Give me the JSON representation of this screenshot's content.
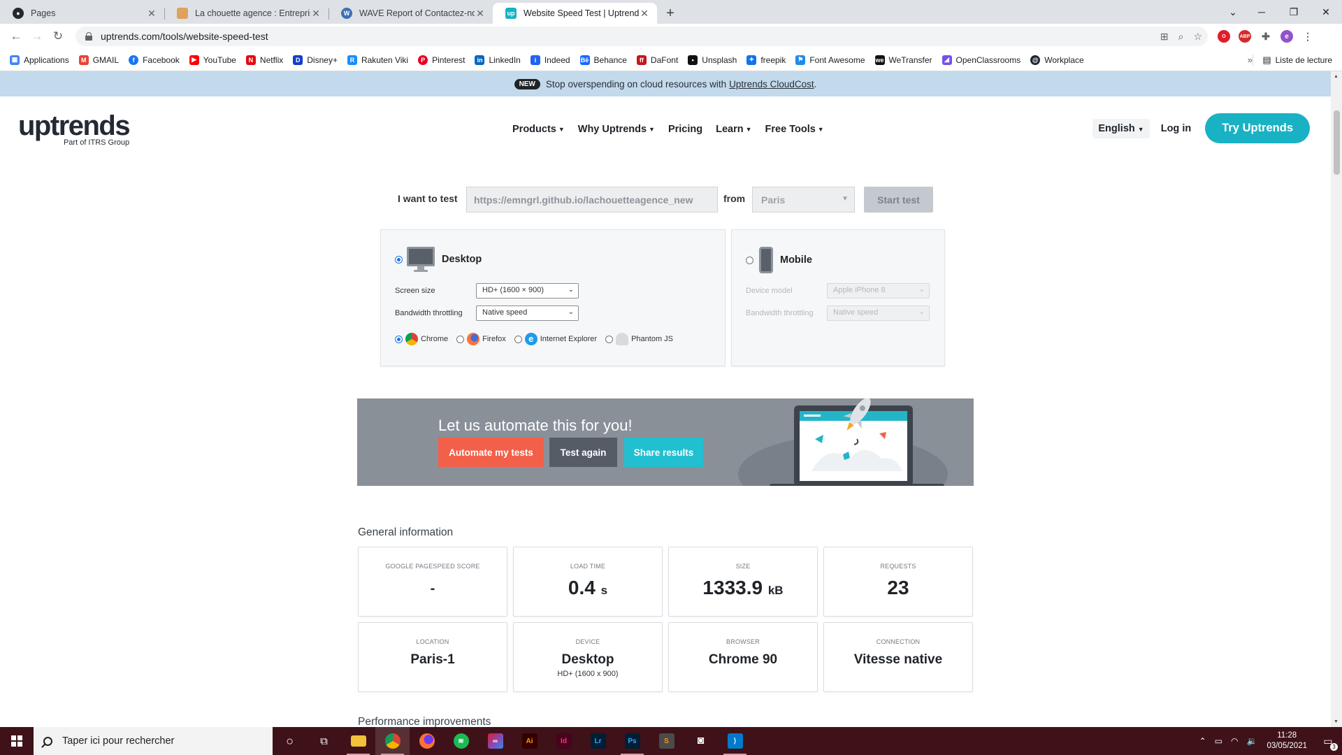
{
  "browser": {
    "tabs": [
      {
        "title": "Pages",
        "favicon": "github-icon",
        "color": "#24292f",
        "active": false
      },
      {
        "title": "La chouette agence : Entreprise w",
        "favicon": "owl-icon",
        "color": "#e0a15a",
        "active": false
      },
      {
        "title": "WAVE Report of Contactez-nous",
        "favicon": "wave-icon",
        "color": "#3c6fb6",
        "active": false
      },
      {
        "title": "Website Speed Test | Uptrends",
        "favicon": "uptrends-icon",
        "color": "#18b2c4",
        "active": true
      }
    ],
    "new_tab": "+",
    "url": "uptrends.com/tools/website-speed-test",
    "bookmarks": [
      {
        "label": "Applications",
        "icon": "apps-grid-icon",
        "color": "#4285f4"
      },
      {
        "label": "GMAIL",
        "icon": "gmail-icon",
        "color": "#ea4335"
      },
      {
        "label": "Facebook",
        "icon": "facebook-icon",
        "color": "#1877f2"
      },
      {
        "label": "YouTube",
        "icon": "youtube-icon",
        "color": "#ff0000"
      },
      {
        "label": "Netflix",
        "icon": "netflix-icon",
        "color": "#e50914"
      },
      {
        "label": "Disney+",
        "icon": "disney-icon",
        "color": "#113ccf"
      },
      {
        "label": "Rakuten Viki",
        "icon": "viki-icon",
        "color": "#1a8cff"
      },
      {
        "label": "Pinterest",
        "icon": "pinterest-icon",
        "color": "#e60023"
      },
      {
        "label": "LinkedIn",
        "icon": "linkedin-icon",
        "color": "#0a66c2"
      },
      {
        "label": "Indeed",
        "icon": "indeed-icon",
        "color": "#2164f3"
      },
      {
        "label": "Behance",
        "icon": "behance-icon",
        "color": "#1769ff"
      },
      {
        "label": "DaFont",
        "icon": "dafont-icon",
        "color": "#c4161c"
      },
      {
        "label": "Unsplash",
        "icon": "unsplash-icon",
        "color": "#111111"
      },
      {
        "label": "freepik",
        "icon": "freepik-icon",
        "color": "#1273eb"
      },
      {
        "label": "Font Awesome",
        "icon": "fontawesome-icon",
        "color": "#228ae6"
      },
      {
        "label": "WeTransfer",
        "icon": "wetransfer-icon",
        "color": "#111111"
      },
      {
        "label": "OpenClassrooms",
        "icon": "openclassrooms-icon",
        "color": "#7451eb"
      },
      {
        "label": "Workplace",
        "icon": "workplace-icon",
        "color": "#20252d"
      }
    ],
    "bookmarks_more": "»",
    "reading_list": "Liste de lecture"
  },
  "promo": {
    "badge": "NEW",
    "text": "Stop overspending on cloud resources with",
    "link": "Uptrends CloudCost",
    "suffix": "."
  },
  "header": {
    "logo": "uptrends",
    "logo_sub": "Part of ITRS Group",
    "nav": [
      "Products",
      "Why Uptrends",
      "Pricing",
      "Learn",
      "Free Tools"
    ],
    "language": "English",
    "login": "Log in",
    "cta": "Try Uptrends"
  },
  "test_form": {
    "want_label": "I want to test",
    "url_value": "https://emngrl.github.io/lachouetteagence_new",
    "from_label": "from",
    "location": "Paris",
    "start_label": "Start test"
  },
  "desktop": {
    "title": "Desktop",
    "screen_size_label": "Screen size",
    "screen_size": "HD+ (1600 × 900)",
    "bandwidth_label": "Bandwidth throttling",
    "bandwidth": "Native speed",
    "browsers": [
      "Chrome",
      "Firefox",
      "Internet Explorer",
      "Phantom JS"
    ],
    "selected_browser": "Chrome"
  },
  "mobile": {
    "title": "Mobile",
    "device_label": "Device model",
    "device": "Apple iPhone 8",
    "bandwidth_label": "Bandwidth throttling",
    "bandwidth": "Native speed"
  },
  "automate": {
    "title": "Let us automate this for you!",
    "btn_automate": "Automate my tests",
    "btn_again": "Test again",
    "btn_share": "Share results"
  },
  "general": {
    "title": "General information",
    "pagespeed": {
      "label": "GOOGLE PAGESPEED SCORE",
      "value": "-"
    },
    "load_time": {
      "label": "LOAD TIME",
      "value": "0.4",
      "unit": "s"
    },
    "size": {
      "label": "SIZE",
      "value": "1333.9",
      "unit": "kB"
    },
    "requests": {
      "label": "REQUESTS",
      "value": "23"
    },
    "location": {
      "label": "LOCATION",
      "value": "Paris-1"
    },
    "device": {
      "label": "DEVICE",
      "value": "Desktop",
      "sub": "HD+ (1600 x 900)"
    },
    "browser": {
      "label": "BROWSER",
      "value": "Chrome 90"
    },
    "connection": {
      "label": "CONNECTION",
      "value": "Vitesse native"
    }
  },
  "performance_title": "Performance improvements",
  "taskbar": {
    "search_placeholder": "Taper ici pour rechercher",
    "apps": [
      {
        "name": "cortana-icon",
        "label": "○",
        "color": "transparent"
      },
      {
        "name": "task-view-icon",
        "label": "⧉",
        "color": "transparent"
      },
      {
        "name": "file-explorer-icon",
        "label": "",
        "color": "#f3c13a"
      },
      {
        "name": "chrome-icon",
        "label": "",
        "color": "#db4437"
      },
      {
        "name": "firefox-icon",
        "label": "",
        "color": "#ff7139"
      },
      {
        "name": "spotify-icon",
        "label": "",
        "color": "#1db954"
      },
      {
        "name": "creative-cloud-icon",
        "label": "",
        "color": "#da1f26"
      },
      {
        "name": "illustrator-icon",
        "label": "Ai",
        "color": "#330000"
      },
      {
        "name": "indesign-icon",
        "label": "Id",
        "color": "#49021f"
      },
      {
        "name": "lightroom-icon",
        "label": "Lr",
        "color": "#001e36"
      },
      {
        "name": "photoshop-icon",
        "label": "Ps",
        "color": "#001e36"
      },
      {
        "name": "sublime-icon",
        "label": "S",
        "color": "#4b4b4b"
      },
      {
        "name": "vr-headset-icon",
        "label": "◙",
        "color": "transparent"
      },
      {
        "name": "vscode-icon",
        "label": "",
        "color": "#007acc"
      }
    ],
    "time": "11:28",
    "date": "03/05/2021",
    "notifications": "3"
  }
}
